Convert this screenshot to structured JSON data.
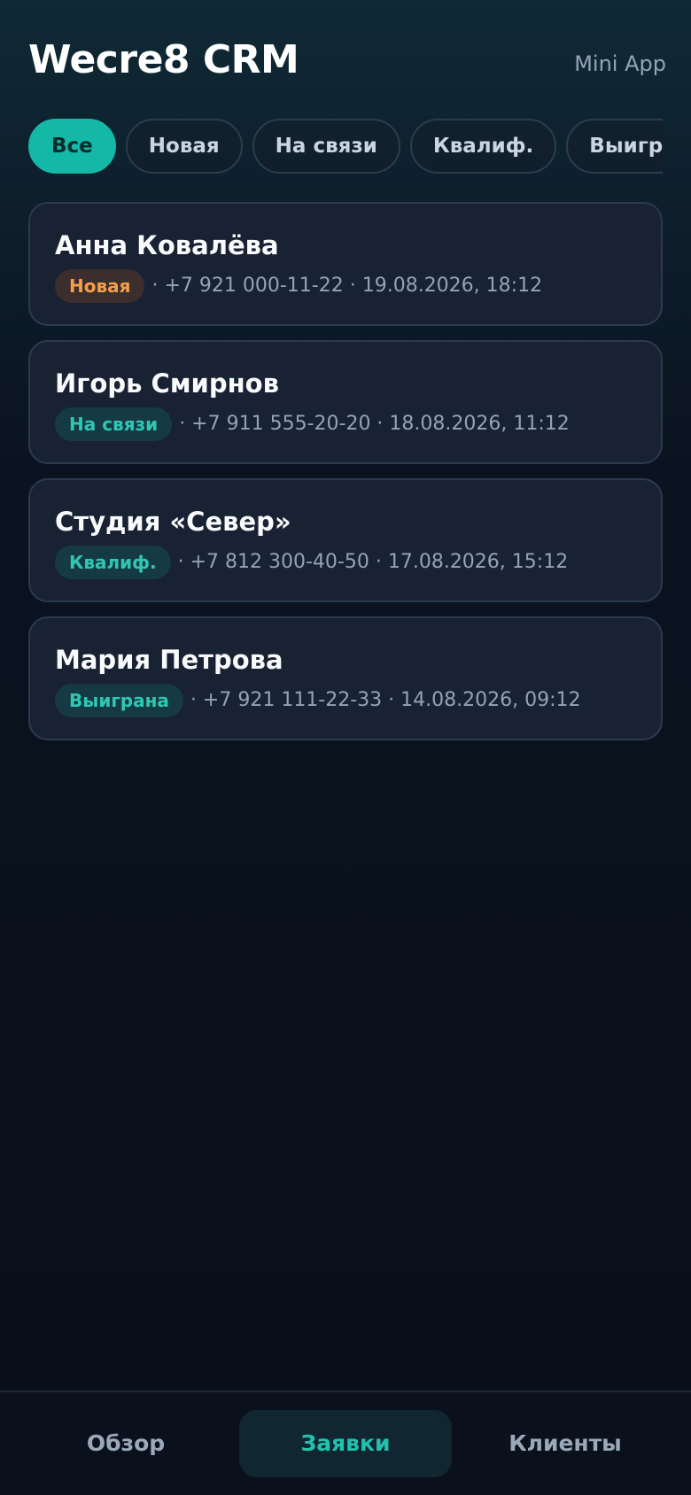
{
  "header": {
    "title": "Wecre8 CRM",
    "subtitle": "Mini App"
  },
  "filters": {
    "chips": [
      {
        "label": "Все",
        "active": true
      },
      {
        "label": "Новая",
        "active": false
      },
      {
        "label": "На связи",
        "active": false
      },
      {
        "label": "Квалиф.",
        "active": false
      },
      {
        "label": "Выиграна",
        "active": false
      }
    ]
  },
  "leads": [
    {
      "name": "Анна Ковалёва",
      "status": "Новая",
      "meta": "· +7 921 000-11-22 · 19.08.2026, 18:12"
    },
    {
      "name": "Игорь Смирнов",
      "status": "На связи",
      "meta": "· +7 911 555-20-20 · 18.08.2026, 11:12"
    },
    {
      "name": "Студия «Север»",
      "status": "Квалиф.",
      "meta": "· +7 812 300-40-50 · 17.08.2026, 15:12"
    },
    {
      "name": "Мария Петрова",
      "status": "Выиграна",
      "meta": "· +7 921 111-22-33 · 14.08.2026, 09:12"
    }
  ],
  "nav": {
    "overview": "Обзор",
    "leads": "Заявки",
    "clients": "Клиенты",
    "active": "leads"
  },
  "colors": {
    "accent": "#14b8a6",
    "status_new": "#f59e4a",
    "status_other": "#2fc7b3",
    "card_bg": "#182233"
  }
}
